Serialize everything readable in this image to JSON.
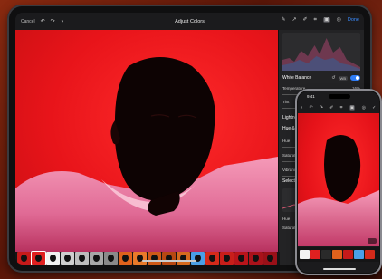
{
  "topbar": {
    "cancel_label": "Cancel",
    "title": "Adjust Colors",
    "done_label": "Done"
  },
  "panel": {
    "white_balance": {
      "title": "White Balance",
      "badge": "WB",
      "temperature_label": "Temperature",
      "temperature_value": "16%",
      "temperature_level": 0.58,
      "tint_label": "Tint",
      "tint_value": "0%",
      "tint_level": 0.5
    },
    "lightness_label": "Lightness",
    "hue_sat_label": "Hue & Saturation",
    "hue_label": "Hue",
    "saturation_label": "Saturation",
    "vibrance_label": "Vibrance",
    "selective_label": "Selective",
    "hue2_label": "Hue",
    "saturation2_label": "Saturation"
  },
  "filmstrip": {
    "labels": [
      "",
      "080",
      "001",
      "002",
      "003",
      "004",
      "005",
      "006",
      "007",
      "008",
      "009",
      "010",
      "011",
      "012",
      "013",
      "014",
      "015",
      "016"
    ]
  },
  "phone": {
    "time": "9:41"
  },
  "colors": {
    "accent": "#2f7cf6",
    "photo_red": "#e8141a",
    "panel_bg": "#232325"
  },
  "icons": [
    "undo-icon",
    "redo-icon",
    "compare-icon",
    "brush-icon",
    "eyedropper-icon",
    "pencil-icon",
    "crop-icon",
    "layers-icon",
    "more-icon",
    "reset-icon",
    "checkmark-icon",
    "back-icon"
  ]
}
